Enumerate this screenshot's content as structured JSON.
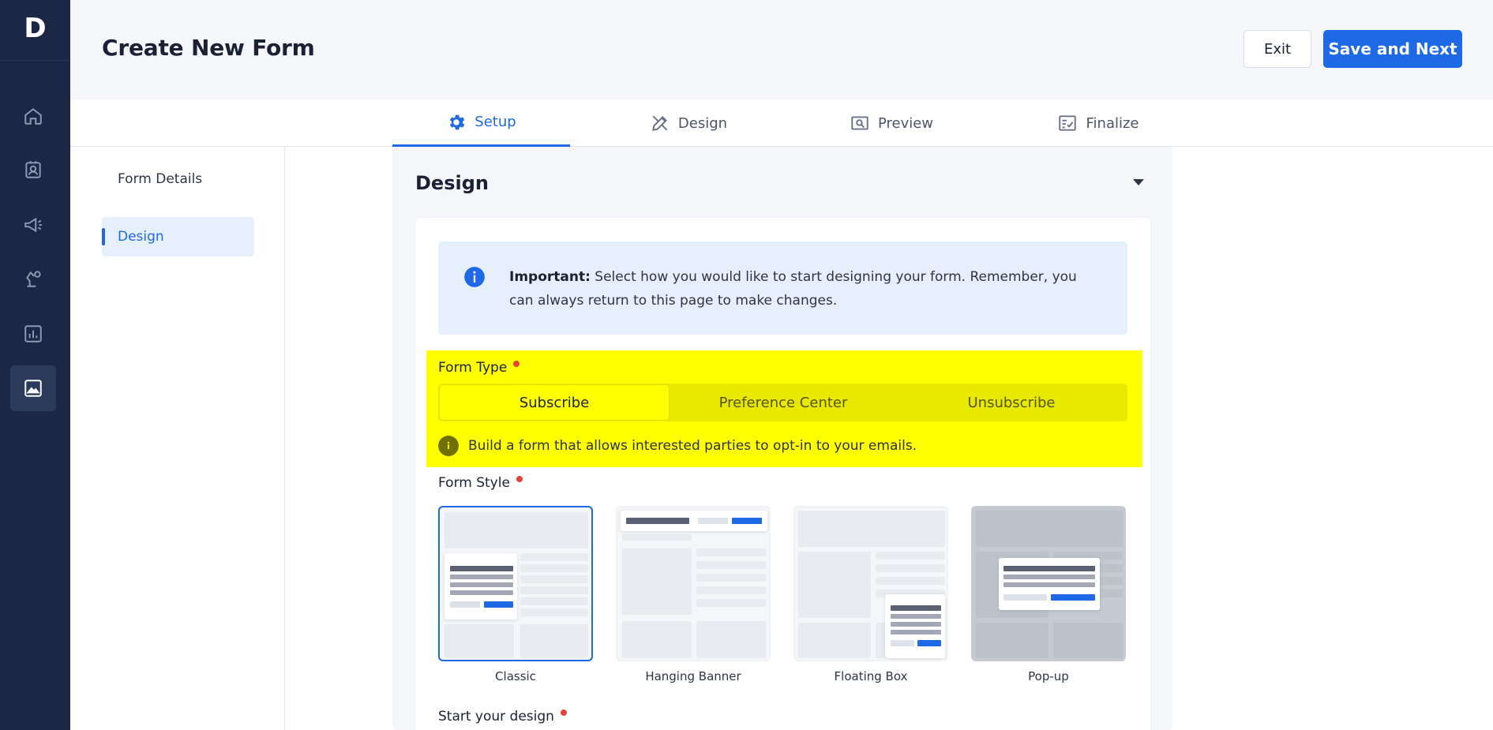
{
  "app": {
    "logo_letter": "D"
  },
  "sidebar": {
    "items": [
      {
        "name": "home-icon",
        "active": false
      },
      {
        "name": "contacts-icon",
        "active": false
      },
      {
        "name": "campaigns-icon",
        "active": false
      },
      {
        "name": "automation-icon",
        "active": false
      },
      {
        "name": "reports-icon",
        "active": false
      },
      {
        "name": "forms-icon",
        "active": true
      }
    ]
  },
  "header": {
    "title": "Create New Form",
    "exit_label": "Exit",
    "save_label": "Save and Next"
  },
  "tabs": [
    {
      "label": "Setup",
      "icon": "gear-icon",
      "active": true
    },
    {
      "label": "Design",
      "icon": "design-tools-icon",
      "active": false
    },
    {
      "label": "Preview",
      "icon": "preview-icon",
      "active": false
    },
    {
      "label": "Finalize",
      "icon": "finalize-checklist-icon",
      "active": false
    }
  ],
  "subnav": {
    "items": [
      {
        "label": "Form Details",
        "active": false
      },
      {
        "label": "Design",
        "active": true
      }
    ]
  },
  "section": {
    "title": "Design",
    "alert": {
      "bold": "Important:",
      "text": " Select how you would like to start designing your form. Remember, you can always return to this page to make changes."
    },
    "form_type": {
      "label": "Form Type",
      "options": [
        "Subscribe",
        "Preference Center",
        "Unsubscribe"
      ],
      "selected": "Subscribe",
      "hint": "Build a form that allows interested parties to opt-in to your emails."
    },
    "form_style": {
      "label": "Form Style",
      "options": [
        "Classic",
        "Hanging Banner",
        "Floating Box",
        "Pop-up"
      ],
      "selected": "Classic"
    },
    "start_design": {
      "label": "Start your design"
    }
  },
  "colors": {
    "accent": "#1e6ae6",
    "sidebar": "#1b2744",
    "highlight": "#ffff00",
    "required": "#e8413c"
  }
}
